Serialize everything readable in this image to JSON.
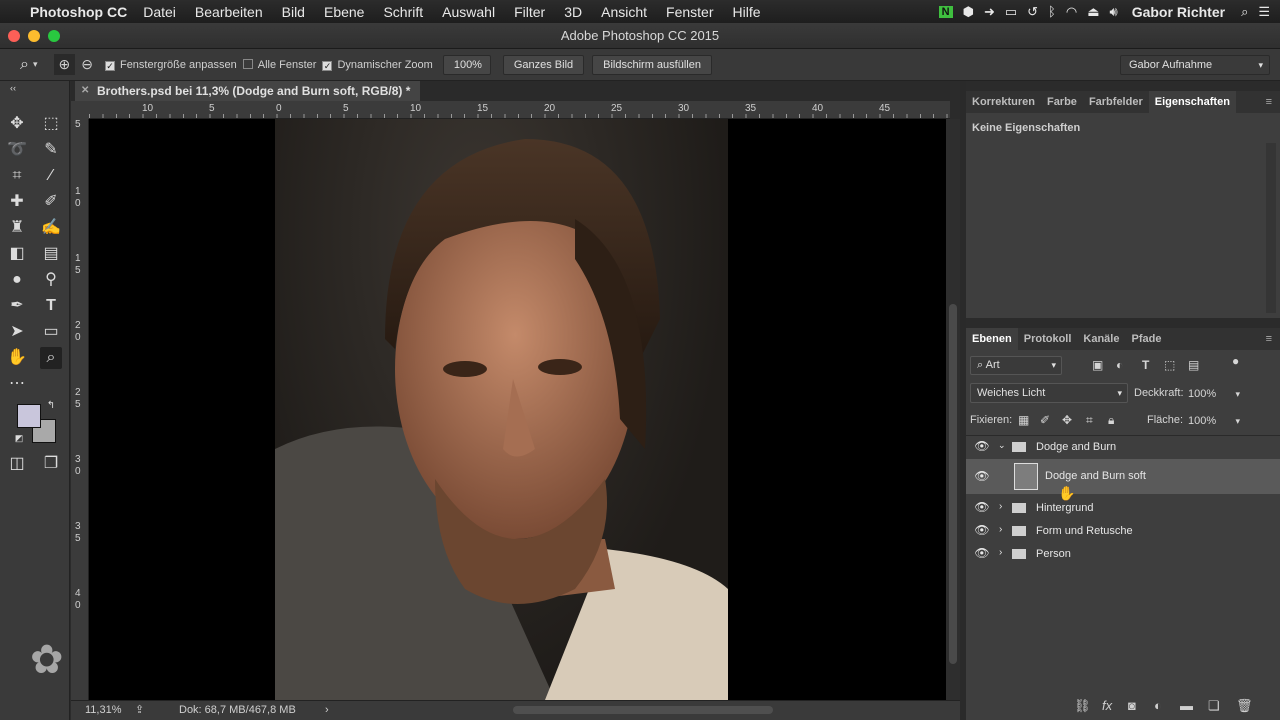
{
  "menubar": {
    "app": "Photoshop CC",
    "items": [
      "Datei",
      "Bearbeiten",
      "Bild",
      "Ebene",
      "Schrift",
      "Auswahl",
      "Filter",
      "3D",
      "Ansicht",
      "Fenster",
      "Hilfe"
    ],
    "user": "Gabor Richter"
  },
  "window": {
    "title": "Adobe Photoshop CC 2015"
  },
  "options": {
    "fit_window_label": "Fenstergröße anpassen",
    "all_windows_label": "Alle Fenster",
    "scrubby_zoom_label": "Dynamischer Zoom",
    "zoom_100_label": "100%",
    "fit_screen_label": "Ganzes Bild",
    "fill_screen_label": "Bildschirm ausfüllen",
    "workspace": "Gabor Aufnahme"
  },
  "document": {
    "tab_title": "Brothers.psd bei 11,3% (Dodge and Burn soft, RGB/8) *",
    "zoom": "11,31%",
    "doc_size": "Dok: 68,7 MB/467,8 MB"
  },
  "rulers": {
    "top": [
      "10",
      "5",
      "0",
      "5",
      "10",
      "15",
      "20",
      "25",
      "30",
      "35",
      "40",
      "45"
    ],
    "left": [
      "5",
      "1 0",
      "1 5",
      "2 0",
      "2 5",
      "3 0",
      "3 5",
      "4 0"
    ]
  },
  "properties_panel": {
    "tabs": [
      "Korrekturen",
      "Farbe",
      "Farbfelder",
      "Eigenschaften"
    ],
    "active_tab": "Eigenschaften",
    "empty_text": "Keine Eigenschaften"
  },
  "layers_panel": {
    "tabs": [
      "Ebenen",
      "Protokoll",
      "Kanäle",
      "Pfade"
    ],
    "active_tab": "Ebenen",
    "filter": "Art",
    "blend_mode": "Weiches Licht",
    "opacity_label": "Deckkraft:",
    "opacity": "100%",
    "lock_label": "Fixieren:",
    "fill_label": "Fläche:",
    "fill": "100%",
    "layers": [
      {
        "name": "Dodge and Burn",
        "type": "group",
        "expanded": true,
        "selected": false
      },
      {
        "name": "Dodge and Burn soft",
        "type": "layer",
        "selected": true
      },
      {
        "name": "Hintergrund",
        "type": "group",
        "expanded": false,
        "selected": false
      },
      {
        "name": "Form und Retusche",
        "type": "group",
        "expanded": false,
        "selected": false
      },
      {
        "name": "Person",
        "type": "group",
        "expanded": false,
        "selected": false
      }
    ]
  },
  "colors": {
    "foreground": "#c9c6dc",
    "background": "#a9a9a9",
    "accent_traffic_red": "#fc5f57"
  }
}
